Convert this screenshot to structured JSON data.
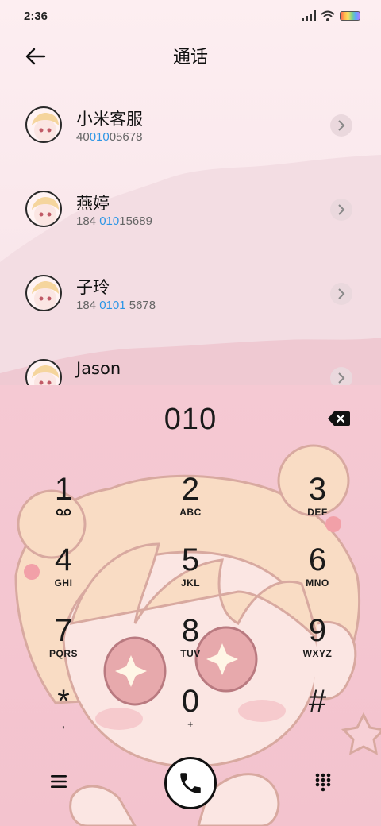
{
  "status_bar": {
    "time": "2:36",
    "icons": [
      "signal-icon",
      "wifi-icon",
      "battery-icon"
    ]
  },
  "header": {
    "title": "通话",
    "back_icon": "arrow-left-icon"
  },
  "contacts": [
    {
      "name": "小米客服",
      "number_pre": "40",
      "number_match": "010",
      "number_post": "05678"
    },
    {
      "name": "燕婷",
      "number_pre": "184 ",
      "number_match": "010",
      "number_post": "15689"
    },
    {
      "name": "子玲",
      "number_pre": "184 ",
      "number_match": "0101",
      "number_post": " 5678"
    },
    {
      "name": "Jason",
      "number_pre": "",
      "number_match": "",
      "number_post": ""
    }
  ],
  "dialer": {
    "display": "010",
    "keys": [
      {
        "digit": "1",
        "sub": ""
      },
      {
        "digit": "2",
        "sub": "ABC"
      },
      {
        "digit": "3",
        "sub": "DEF"
      },
      {
        "digit": "4",
        "sub": "GHI"
      },
      {
        "digit": "5",
        "sub": "JKL"
      },
      {
        "digit": "6",
        "sub": "MNO"
      },
      {
        "digit": "7",
        "sub": "PQRS"
      },
      {
        "digit": "8",
        "sub": "TUV"
      },
      {
        "digit": "9",
        "sub": "WXYZ"
      },
      {
        "digit": "*",
        "sub": ","
      },
      {
        "digit": "0",
        "sub": "+"
      },
      {
        "digit": "#",
        "sub": ""
      }
    ]
  },
  "bottom_bar": {
    "menu_icon": "hamburger-menu-icon",
    "call_icon": "phone-icon",
    "keypad_icon": "dialpad-icon"
  },
  "colors": {
    "highlight": "#2d96e6",
    "top_bg": "#fdeef1",
    "dialer_bg": "#f5c9d3"
  }
}
